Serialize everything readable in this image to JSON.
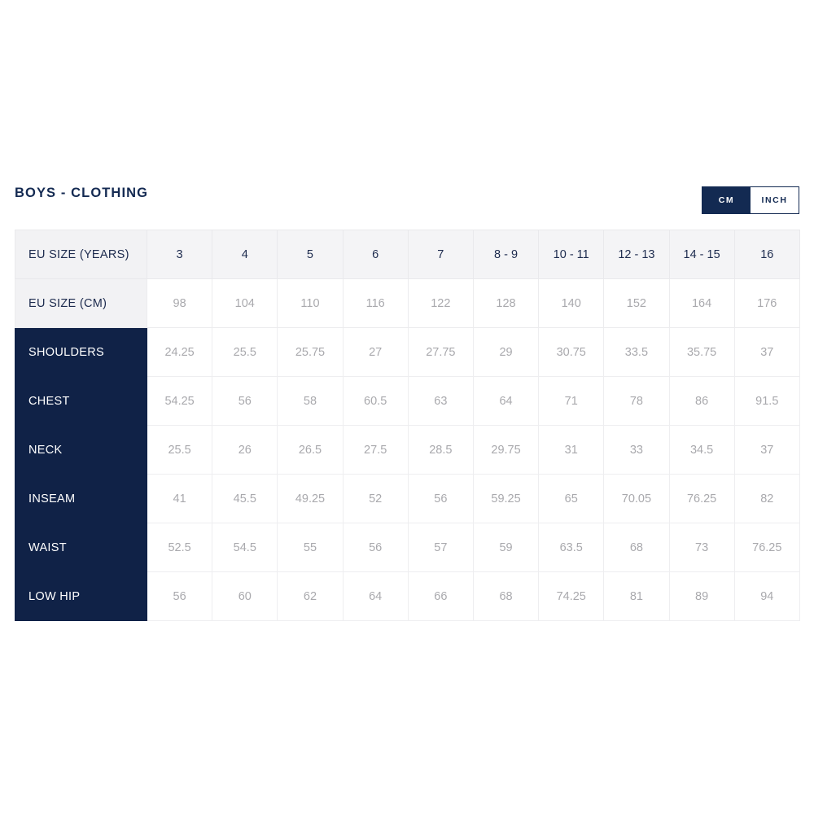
{
  "page": {
    "title": "BOYS - CLOTHING",
    "background_color": "#ffffff",
    "accent_navy": "#102247",
    "title_color": "#142a52",
    "value_text_color": "#a9a9ad",
    "header_row_background": "#f4f4f6"
  },
  "unit_toggle": {
    "active": "CM",
    "options": [
      {
        "label": "CM",
        "state": "active"
      },
      {
        "label": "INCH",
        "state": "inactive"
      }
    ]
  },
  "table": {
    "header_rows": [
      {
        "label": "EU SIZE (YEARS)",
        "values": [
          "3",
          "4",
          "5",
          "6",
          "7",
          "8 - 9",
          "10 - 11",
          "12 - 13",
          "14 - 15",
          "16"
        ]
      },
      {
        "label": "EU SIZE (CM)",
        "values": [
          "98",
          "104",
          "110",
          "116",
          "122",
          "128",
          "140",
          "152",
          "164",
          "176"
        ]
      }
    ],
    "measurement_rows": [
      {
        "label": "SHOULDERS",
        "values": [
          "24.25",
          "25.5",
          "25.75",
          "27",
          "27.75",
          "29",
          "30.75",
          "33.5",
          "35.75",
          "37"
        ]
      },
      {
        "label": "CHEST",
        "values": [
          "54.25",
          "56",
          "58",
          "60.5",
          "63",
          "64",
          "71",
          "78",
          "86",
          "91.5"
        ]
      },
      {
        "label": "NECK",
        "values": [
          "25.5",
          "26",
          "26.5",
          "27.5",
          "28.5",
          "29.75",
          "31",
          "33",
          "34.5",
          "37"
        ]
      },
      {
        "label": "INSEAM",
        "values": [
          "41",
          "45.5",
          "49.25",
          "52",
          "56",
          "59.25",
          "65",
          "70.05",
          "76.25",
          "82"
        ]
      },
      {
        "label": "WAIST",
        "values": [
          "52.5",
          "54.5",
          "55",
          "56",
          "57",
          "59",
          "63.5",
          "68",
          "73",
          "76.25"
        ]
      },
      {
        "label": "LOW HIP",
        "values": [
          "56",
          "60",
          "62",
          "64",
          "66",
          "68",
          "74.25",
          "81",
          "89",
          "94"
        ]
      }
    ]
  }
}
